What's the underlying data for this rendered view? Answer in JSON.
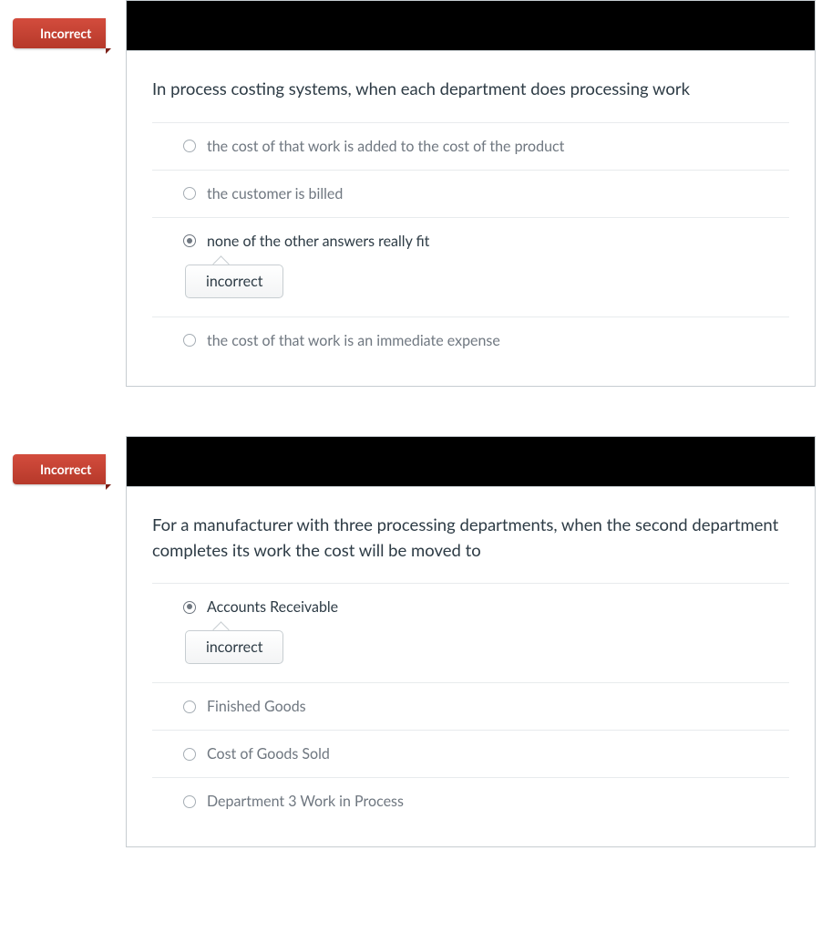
{
  "questions": [
    {
      "flag": "Incorrect",
      "stem": "In process costing systems, when each department does processing work",
      "options": [
        {
          "label": "the cost of that work is added to the cost of the product",
          "selected": false
        },
        {
          "label": "the customer is billed",
          "selected": false
        },
        {
          "label": "none of the other answers really fit",
          "selected": true,
          "feedback": "incorrect"
        },
        {
          "label": "the cost of that work is an immediate expense",
          "selected": false
        }
      ]
    },
    {
      "flag": "Incorrect",
      "stem": "For a manufacturer with three processing departments, when the second department completes its work the cost will be moved to",
      "options": [
        {
          "label": "Accounts Receivable",
          "selected": true,
          "feedback": "incorrect"
        },
        {
          "label": "Finished Goods",
          "selected": false
        },
        {
          "label": "Cost of Goods Sold",
          "selected": false
        },
        {
          "label": "Department 3 Work in Process",
          "selected": false
        }
      ]
    }
  ]
}
